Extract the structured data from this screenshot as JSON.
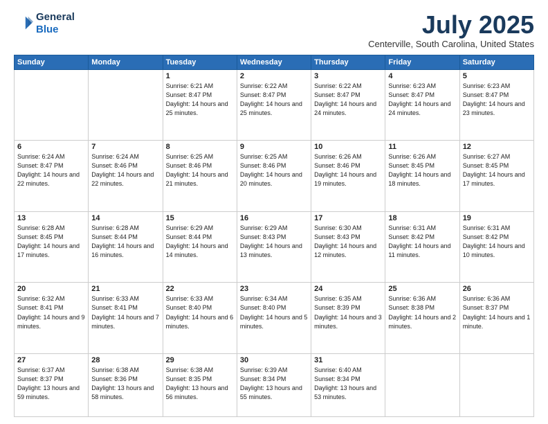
{
  "logo": {
    "line1": "General",
    "line2": "Blue"
  },
  "header": {
    "title": "July 2025",
    "subtitle": "Centerville, South Carolina, United States"
  },
  "days": [
    "Sunday",
    "Monday",
    "Tuesday",
    "Wednesday",
    "Thursday",
    "Friday",
    "Saturday"
  ],
  "weeks": [
    [
      {
        "day": "",
        "content": ""
      },
      {
        "day": "",
        "content": ""
      },
      {
        "day": "1",
        "content": "Sunrise: 6:21 AM\nSunset: 8:47 PM\nDaylight: 14 hours and 25 minutes."
      },
      {
        "day": "2",
        "content": "Sunrise: 6:22 AM\nSunset: 8:47 PM\nDaylight: 14 hours and 25 minutes."
      },
      {
        "day": "3",
        "content": "Sunrise: 6:22 AM\nSunset: 8:47 PM\nDaylight: 14 hours and 24 minutes."
      },
      {
        "day": "4",
        "content": "Sunrise: 6:23 AM\nSunset: 8:47 PM\nDaylight: 14 hours and 24 minutes."
      },
      {
        "day": "5",
        "content": "Sunrise: 6:23 AM\nSunset: 8:47 PM\nDaylight: 14 hours and 23 minutes."
      }
    ],
    [
      {
        "day": "6",
        "content": "Sunrise: 6:24 AM\nSunset: 8:47 PM\nDaylight: 14 hours and 22 minutes."
      },
      {
        "day": "7",
        "content": "Sunrise: 6:24 AM\nSunset: 8:46 PM\nDaylight: 14 hours and 22 minutes."
      },
      {
        "day": "8",
        "content": "Sunrise: 6:25 AM\nSunset: 8:46 PM\nDaylight: 14 hours and 21 minutes."
      },
      {
        "day": "9",
        "content": "Sunrise: 6:25 AM\nSunset: 8:46 PM\nDaylight: 14 hours and 20 minutes."
      },
      {
        "day": "10",
        "content": "Sunrise: 6:26 AM\nSunset: 8:46 PM\nDaylight: 14 hours and 19 minutes."
      },
      {
        "day": "11",
        "content": "Sunrise: 6:26 AM\nSunset: 8:45 PM\nDaylight: 14 hours and 18 minutes."
      },
      {
        "day": "12",
        "content": "Sunrise: 6:27 AM\nSunset: 8:45 PM\nDaylight: 14 hours and 17 minutes."
      }
    ],
    [
      {
        "day": "13",
        "content": "Sunrise: 6:28 AM\nSunset: 8:45 PM\nDaylight: 14 hours and 17 minutes."
      },
      {
        "day": "14",
        "content": "Sunrise: 6:28 AM\nSunset: 8:44 PM\nDaylight: 14 hours and 16 minutes."
      },
      {
        "day": "15",
        "content": "Sunrise: 6:29 AM\nSunset: 8:44 PM\nDaylight: 14 hours and 14 minutes."
      },
      {
        "day": "16",
        "content": "Sunrise: 6:29 AM\nSunset: 8:43 PM\nDaylight: 14 hours and 13 minutes."
      },
      {
        "day": "17",
        "content": "Sunrise: 6:30 AM\nSunset: 8:43 PM\nDaylight: 14 hours and 12 minutes."
      },
      {
        "day": "18",
        "content": "Sunrise: 6:31 AM\nSunset: 8:42 PM\nDaylight: 14 hours and 11 minutes."
      },
      {
        "day": "19",
        "content": "Sunrise: 6:31 AM\nSunset: 8:42 PM\nDaylight: 14 hours and 10 minutes."
      }
    ],
    [
      {
        "day": "20",
        "content": "Sunrise: 6:32 AM\nSunset: 8:41 PM\nDaylight: 14 hours and 9 minutes."
      },
      {
        "day": "21",
        "content": "Sunrise: 6:33 AM\nSunset: 8:41 PM\nDaylight: 14 hours and 7 minutes."
      },
      {
        "day": "22",
        "content": "Sunrise: 6:33 AM\nSunset: 8:40 PM\nDaylight: 14 hours and 6 minutes."
      },
      {
        "day": "23",
        "content": "Sunrise: 6:34 AM\nSunset: 8:40 PM\nDaylight: 14 hours and 5 minutes."
      },
      {
        "day": "24",
        "content": "Sunrise: 6:35 AM\nSunset: 8:39 PM\nDaylight: 14 hours and 3 minutes."
      },
      {
        "day": "25",
        "content": "Sunrise: 6:36 AM\nSunset: 8:38 PM\nDaylight: 14 hours and 2 minutes."
      },
      {
        "day": "26",
        "content": "Sunrise: 6:36 AM\nSunset: 8:37 PM\nDaylight: 14 hours and 1 minute."
      }
    ],
    [
      {
        "day": "27",
        "content": "Sunrise: 6:37 AM\nSunset: 8:37 PM\nDaylight: 13 hours and 59 minutes."
      },
      {
        "day": "28",
        "content": "Sunrise: 6:38 AM\nSunset: 8:36 PM\nDaylight: 13 hours and 58 minutes."
      },
      {
        "day": "29",
        "content": "Sunrise: 6:38 AM\nSunset: 8:35 PM\nDaylight: 13 hours and 56 minutes."
      },
      {
        "day": "30",
        "content": "Sunrise: 6:39 AM\nSunset: 8:34 PM\nDaylight: 13 hours and 55 minutes."
      },
      {
        "day": "31",
        "content": "Sunrise: 6:40 AM\nSunset: 8:34 PM\nDaylight: 13 hours and 53 minutes."
      },
      {
        "day": "",
        "content": ""
      },
      {
        "day": "",
        "content": ""
      }
    ]
  ]
}
